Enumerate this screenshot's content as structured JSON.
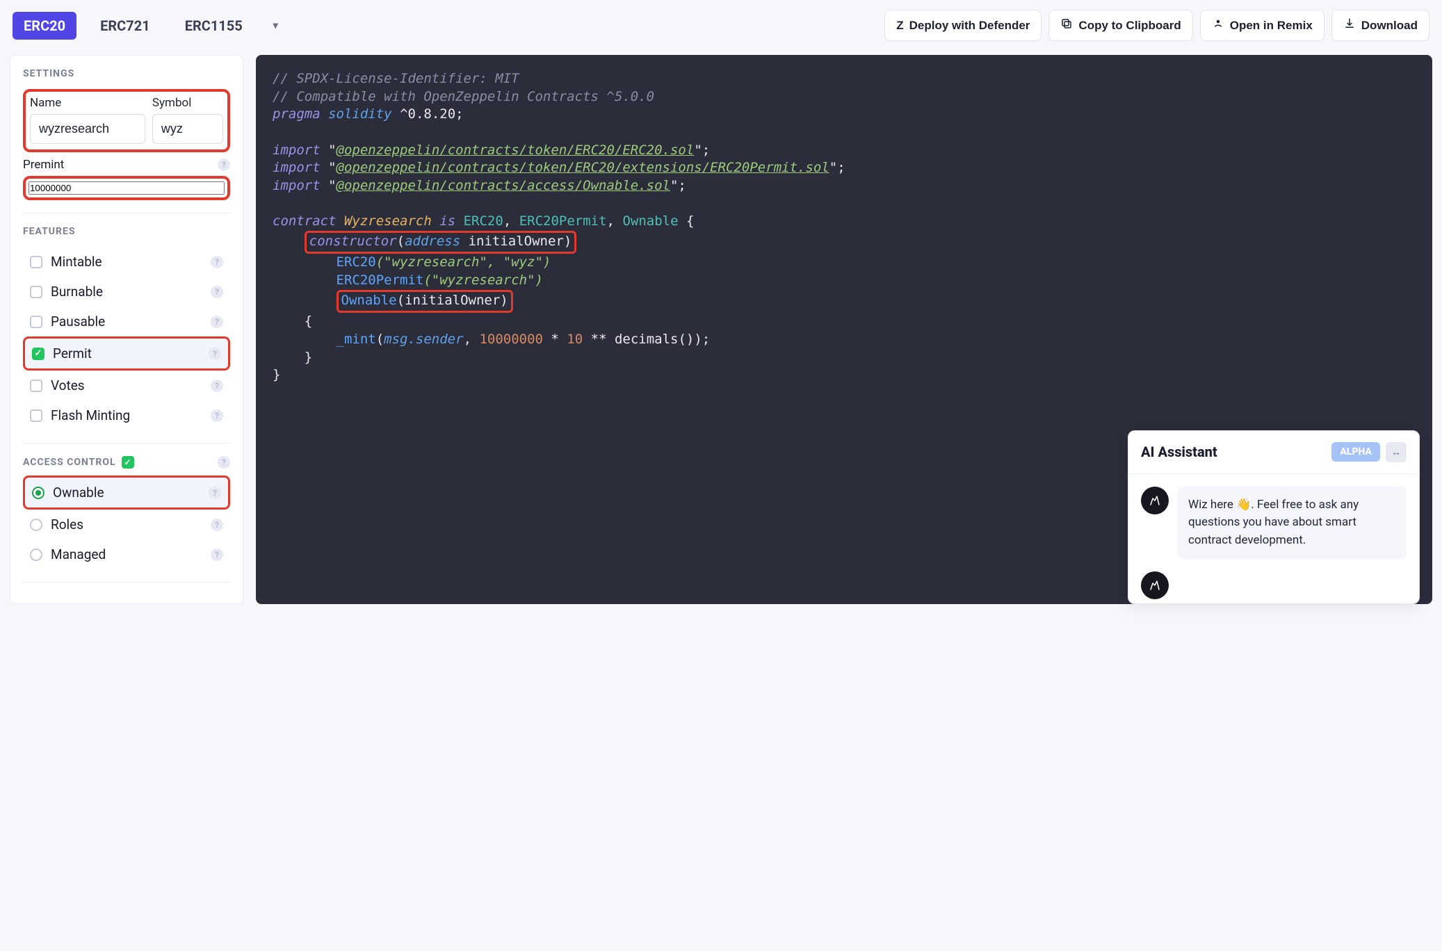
{
  "tabs": {
    "items": [
      "ERC20",
      "ERC721",
      "ERC1155"
    ],
    "active": "ERC20"
  },
  "actions": {
    "deploy": "Deploy with Defender",
    "copy": "Copy to Clipboard",
    "remix": "Open in Remix",
    "download": "Download"
  },
  "settings": {
    "title": "SETTINGS",
    "name_label": "Name",
    "name_value": "wyzresearch",
    "symbol_label": "Symbol",
    "symbol_value": "wyz",
    "premint_label": "Premint",
    "premint_value": "10000000"
  },
  "features": {
    "title": "FEATURES",
    "items": [
      {
        "label": "Mintable",
        "checked": false
      },
      {
        "label": "Burnable",
        "checked": false
      },
      {
        "label": "Pausable",
        "checked": false
      },
      {
        "label": "Permit",
        "checked": true
      },
      {
        "label": "Votes",
        "checked": false
      },
      {
        "label": "Flash Minting",
        "checked": false
      }
    ]
  },
  "access_control": {
    "title": "ACCESS CONTROL",
    "master_checked": true,
    "items": [
      {
        "label": "Ownable",
        "checked": true
      },
      {
        "label": "Roles",
        "checked": false
      },
      {
        "label": "Managed",
        "checked": false
      }
    ]
  },
  "code": {
    "spdx": "// SPDX-License-Identifier: MIT",
    "compat": "// Compatible with OpenZeppelin Contracts ^5.0.0",
    "pragma_kw": "pragma",
    "solidity_kw": "solidity",
    "pragma_ver": "^0.8.20",
    "import_kw": "import",
    "imp1": "@openzeppelin/contracts/token/ERC20/ERC20.sol",
    "imp2": "@openzeppelin/contracts/token/ERC20/extensions/ERC20Permit.sol",
    "imp3": "@openzeppelin/contracts/access/Ownable.sol",
    "contract_kw": "contract",
    "contract_name": "Wyzresearch",
    "is_kw": "is",
    "bases": [
      "ERC20",
      "ERC20Permit",
      "Ownable"
    ],
    "ctor_kw": "constructor",
    "addr_kw": "address",
    "param": "initialOwner",
    "erc20_args": "(\"wyzresearch\", \"wyz\")",
    "permit_args": "(\"wyzresearch\")",
    "ownable_call": "Ownable(initialOwner)",
    "mint_fn": "_mint",
    "msg_sender": "msg.sender",
    "mint_num": "10000000",
    "mint_mul": "10",
    "decimals_call": "decimals()"
  },
  "ai": {
    "title": "AI Assistant",
    "badge": "ALPHA",
    "expand_glyph": "↔",
    "msg": "Wiz here 👋. Feel free to ask any questions you have about smart contract development."
  }
}
